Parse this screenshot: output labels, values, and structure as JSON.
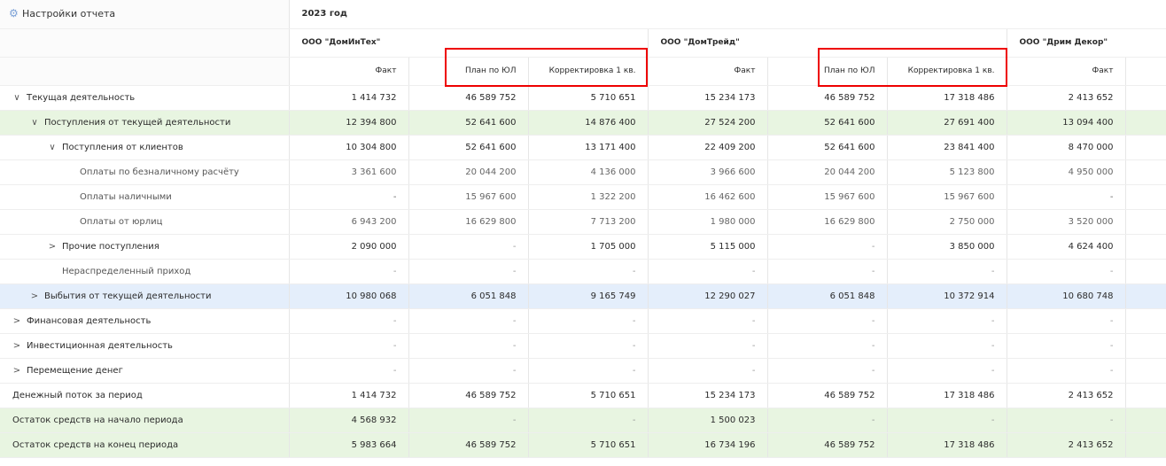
{
  "settings": {
    "label": "Настройки отчета",
    "icon": "gear-icon"
  },
  "year": "2023 год",
  "companies": [
    "ООО \"ДомИнТех\"",
    "ООО \"ДомТрейд\"",
    "ООО \"Дрим Декор\""
  ],
  "columns": [
    "Факт",
    "План по ЮЛ",
    "Корректировка 1 кв.",
    "Факт",
    "План по ЮЛ",
    "Корректировка 1 кв.",
    "Факт"
  ],
  "rows": [
    {
      "label": "Текущая деятельность",
      "chevron": "∨",
      "values": [
        "1 414 732",
        "46 589 752",
        "5 710 651",
        "15 234 173",
        "46 589 752",
        "17 318 486",
        "2 413 652"
      ]
    },
    {
      "label": "Поступления от текущей деятельности",
      "chevron": "∨",
      "values": [
        "12 394 800",
        "52 641 600",
        "14 876 400",
        "27 524 200",
        "52 641 600",
        "27 691 400",
        "13 094 400"
      ]
    },
    {
      "label": "Поступления от клиентов",
      "chevron": "∨",
      "values": [
        "10 304 800",
        "52 641 600",
        "13 171 400",
        "22 409 200",
        "52 641 600",
        "23 841 400",
        "8 470 000"
      ]
    },
    {
      "label": "Оплаты по безналичному расчёту",
      "chevron": "",
      "values": [
        "3 361 600",
        "20 044 200",
        "4 136 000",
        "3 966 600",
        "20 044 200",
        "5 123 800",
        "4 950 000"
      ]
    },
    {
      "label": "Оплаты наличными",
      "chevron": "",
      "values": [
        "-",
        "15 967 600",
        "1 322 200",
        "16 462 600",
        "15 967 600",
        "15 967 600",
        "-"
      ]
    },
    {
      "label": "Оплаты от юрлиц",
      "chevron": "",
      "values": [
        "6 943 200",
        "16 629 800",
        "7 713 200",
        "1 980 000",
        "16 629 800",
        "2 750 000",
        "3 520 000"
      ]
    },
    {
      "label": "Прочие поступления",
      "chevron": ">",
      "values": [
        "2 090 000",
        "-",
        "1 705 000",
        "5 115 000",
        "-",
        "3 850 000",
        "4 624 400"
      ]
    },
    {
      "label": "Нераспределенный приход",
      "chevron": "",
      "values": [
        "-",
        "-",
        "-",
        "-",
        "-",
        "-",
        "-"
      ]
    },
    {
      "label": "Выбытия от текущей деятельности",
      "chevron": ">",
      "values": [
        "10 980 068",
        "6 051 848",
        "9 165 749",
        "12 290 027",
        "6 051 848",
        "10 372 914",
        "10 680 748"
      ]
    },
    {
      "label": "Финансовая деятельность",
      "chevron": ">",
      "values": [
        "-",
        "-",
        "-",
        "-",
        "-",
        "-",
        "-"
      ]
    },
    {
      "label": "Инвестиционная деятельность",
      "chevron": ">",
      "values": [
        "-",
        "-",
        "-",
        "-",
        "-",
        "-",
        "-"
      ]
    },
    {
      "label": "Перемещение денег",
      "chevron": ">",
      "values": [
        "-",
        "-",
        "-",
        "-",
        "-",
        "-",
        "-"
      ]
    },
    {
      "label": "Денежный поток за период",
      "chevron": "",
      "values": [
        "1 414 732",
        "46 589 752",
        "5 710 651",
        "15 234 173",
        "46 589 752",
        "17 318 486",
        "2 413 652"
      ]
    },
    {
      "label": "Остаток средств на начало периода",
      "chevron": "",
      "values": [
        "4 568 932",
        "-",
        "-",
        "1 500 023",
        "-",
        "-",
        "-"
      ]
    },
    {
      "label": "Остаток средств на конец периода",
      "chevron": "",
      "values": [
        "5 983 664",
        "46 589 752",
        "5 710 651",
        "16 734 196",
        "46 589 752",
        "17 318 486",
        "2 413 652"
      ]
    }
  ],
  "colors": {
    "green_row": "#e8f5e1",
    "blue_row": "#e4eefb",
    "highlight_box": "#ee0000",
    "accent": "#7aa0d6"
  }
}
